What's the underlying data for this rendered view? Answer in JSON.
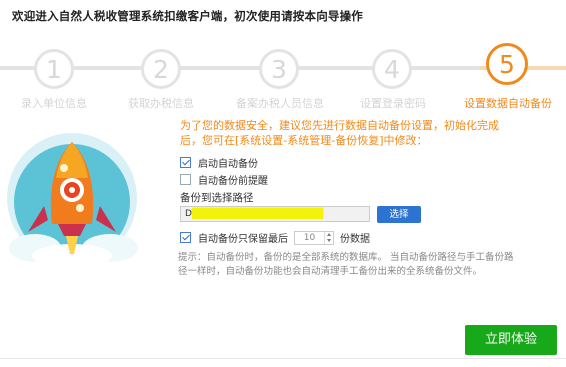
{
  "header": {
    "title": "欢迎进入自然人税收管理系统扣缴客户端，初次使用请按本向导操作"
  },
  "steps": [
    {
      "number": "1",
      "label": "录入单位信息",
      "state": "inactive"
    },
    {
      "number": "2",
      "label": "获取办税信息",
      "state": "inactive"
    },
    {
      "number": "3",
      "label": "备案办税人员信息",
      "state": "inactive"
    },
    {
      "number": "4",
      "label": "设置登录密码",
      "state": "inactive"
    },
    {
      "number": "5",
      "label": "设置数据自动备份",
      "state": "active"
    }
  ],
  "main": {
    "notice": "为了您的数据安全，建议您先进行数据自动备份设置，初始化完成后，您可在[系统设置-系统管理-备份恢复]中修改：",
    "options": {
      "auto_backup": {
        "label": "启动自动备份",
        "checked": true
      },
      "backup_reminder": {
        "label": "自动备份前提醒",
        "checked": false
      }
    },
    "path": {
      "label": "备份到选择路径",
      "value_prefix": "D",
      "value_highlighted": "███████████████████",
      "select_button": "选择"
    },
    "keep": {
      "label": "自动备份只保留最后",
      "checked": true,
      "value": "10",
      "suffix": "份数据"
    },
    "hint": "提示：自动备份时，备份的是全部系统的数据库。  当自动备份路径与手工备份路径一样时，自动备份功能也会自动清理手工备份出来的全系统备份文件。",
    "start_button": "立即体验"
  },
  "colors": {
    "accent": "#f08a1c",
    "primary": "#2d74d2",
    "success": "#18a91b",
    "inactive": "#e3e3e3"
  }
}
